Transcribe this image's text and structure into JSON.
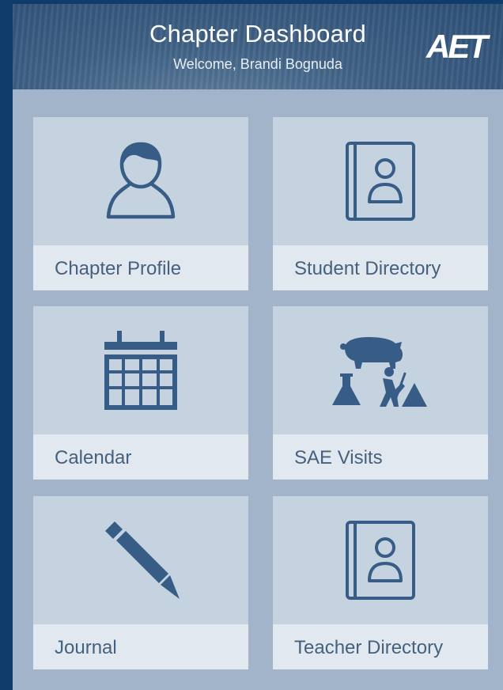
{
  "header": {
    "title": "Chapter Dashboard",
    "welcome": "Welcome, Brandi Bognuda",
    "logo": "AET"
  },
  "colors": {
    "frame": "#0f3c6b",
    "content_bg": "#a1b4c9",
    "tile_bg": "#c5d2df",
    "label_bg": "#e2e8ef",
    "icon": "#375d87",
    "label_text": "#45617d"
  },
  "tiles": [
    {
      "label": "Chapter Profile",
      "icon": "user-profile-icon"
    },
    {
      "label": "Student Directory",
      "icon": "address-book-icon"
    },
    {
      "label": "Calendar",
      "icon": "calendar-icon"
    },
    {
      "label": "SAE Visits",
      "icon": "sae-visits-icon"
    },
    {
      "label": "Journal",
      "icon": "pencil-icon"
    },
    {
      "label": "Teacher Directory",
      "icon": "address-book-icon"
    }
  ]
}
